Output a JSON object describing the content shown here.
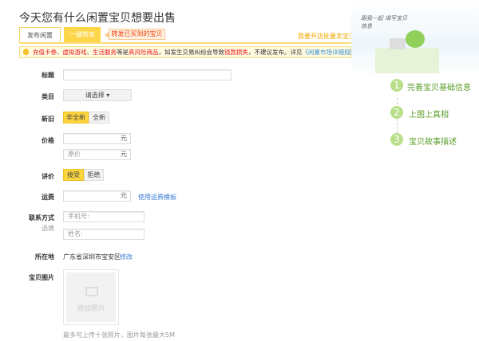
{
  "header": {
    "title": "今天您有什么闲置宝贝想要出售"
  },
  "tabs": [
    {
      "label": "发布闲置"
    },
    {
      "label": "一键转卖"
    }
  ],
  "callout": "转发已买到的宝贝",
  "right_link": "我要开店批量卖宝贝",
  "notice": {
    "p1": "充值卡券",
    "s1": "、",
    "p2": "虚拟游戏",
    "s2": "、",
    "p3": "生活服务",
    "t1": "等是",
    "p4": "高风险商品",
    "t2": "，如发生交易纠纷会导致",
    "p5": "钱款损失",
    "t3": "，不建议发布。详见",
    "link": "《闲置市场详细规则》",
    "t4": "。"
  },
  "form": {
    "title_label": "标题",
    "category_label": "类目",
    "category_value": "请选择",
    "condition_label": "新旧",
    "condition_options": [
      "非全新",
      "全新"
    ],
    "price_label": "价格",
    "unit": "元",
    "orig_price_placeholder": "原价",
    "bargain_label": "讲价",
    "bargain_options": [
      "接受",
      "拒绝"
    ],
    "shipping_label": "运费",
    "shipping_link": "使用运费模板",
    "contact_label": "联系方式",
    "contact_optional": "选填",
    "phone_placeholder": "手机号:",
    "name_placeholder": "姓名:",
    "location_label": "所在地",
    "location_value": "广东省深圳市宝安区",
    "location_edit": "修改",
    "photo_label": "宝贝图片",
    "photo_add": "添加照片",
    "photo_note": "最多可上传十张照片，图片每张最大5M"
  },
  "sidebar": {
    "handwriting": "跟我一起 填写宝贝信息",
    "steps": [
      {
        "n": "1",
        "label": "完善宝贝基础信息"
      },
      {
        "n": "2",
        "label": "上图上真相"
      },
      {
        "n": "3",
        "label": "宝贝故事描述"
      }
    ]
  },
  "colors": {
    "accent": "#fdd53e",
    "link": "#3a7fd5",
    "warning": "#e8161d",
    "step": "#b8e08a"
  }
}
